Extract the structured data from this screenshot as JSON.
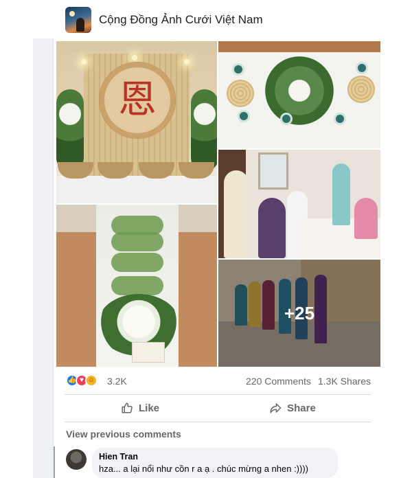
{
  "group": {
    "name": "Cộng Đồng Ảnh Cưới Việt Nam"
  },
  "photos": {
    "plaque_character": "恩",
    "more_count": "+25"
  },
  "stats": {
    "reactions": [
      "like",
      "love",
      "care"
    ],
    "reaction_count": "3.2K",
    "comments": "220 Comments",
    "shares": "1.3K Shares"
  },
  "actions": {
    "like_label": "Like",
    "share_label": "Share"
  },
  "comments_section": {
    "view_previous": "View previous comments",
    "items": [
      {
        "author": "Hien Tran",
        "text": "hza... a lại nổi như cồn r a ạ . chúc mừng a nhen :))))"
      }
    ]
  },
  "colors": {
    "brand_blue": "#1877f2",
    "love_red": "#f33e58",
    "care_yellow": "#f7b125",
    "muted_text": "#65676b"
  }
}
